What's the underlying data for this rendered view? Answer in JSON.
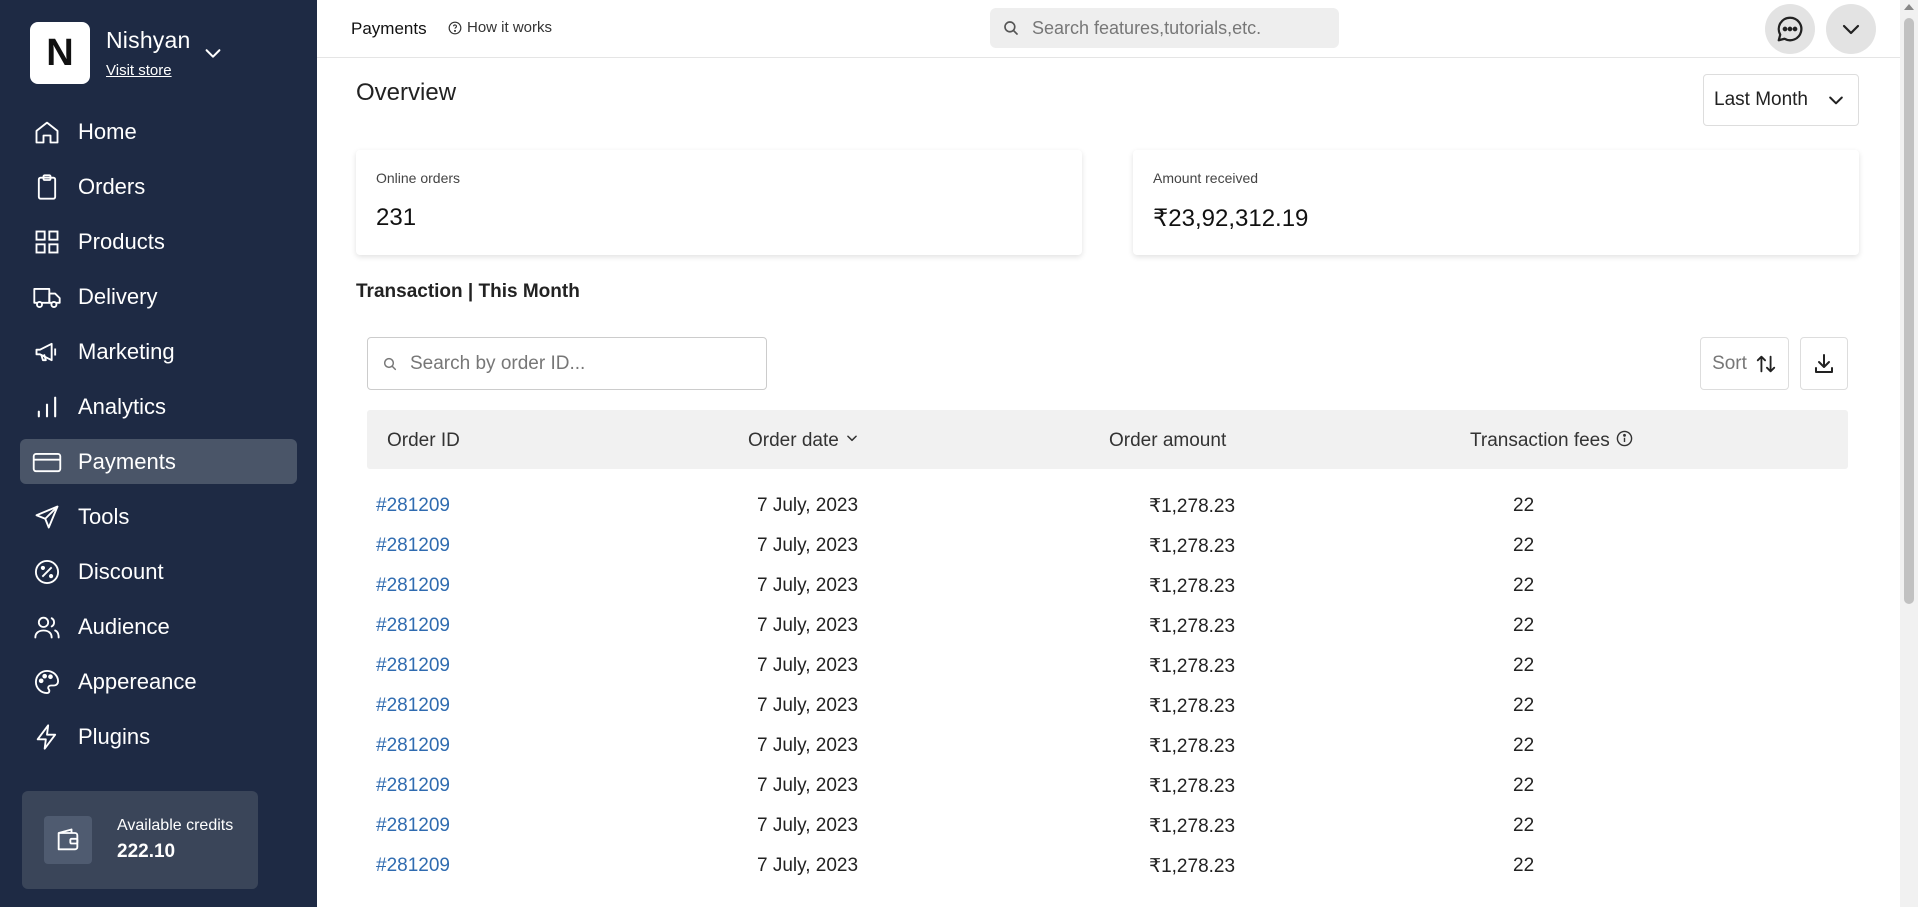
{
  "sidebar": {
    "store": {
      "logo_letter": "N",
      "name": "Nishyan",
      "visit_label": "Visit store"
    },
    "items": [
      {
        "label": "Home",
        "icon": "home-icon"
      },
      {
        "label": "Orders",
        "icon": "clipboard-icon"
      },
      {
        "label": "Products",
        "icon": "grid-icon"
      },
      {
        "label": "Delivery",
        "icon": "truck-icon"
      },
      {
        "label": "Marketing",
        "icon": "megaphone-icon"
      },
      {
        "label": "Analytics",
        "icon": "bar-chart-icon"
      },
      {
        "label": "Payments",
        "icon": "credit-card-icon",
        "active": true
      },
      {
        "label": "Tools",
        "icon": "send-icon"
      },
      {
        "label": "Discount",
        "icon": "discount-icon"
      },
      {
        "label": "Audience",
        "icon": "users-icon"
      },
      {
        "label": "Appereance",
        "icon": "palette-icon"
      },
      {
        "label": "Plugins",
        "icon": "lightning-icon"
      }
    ],
    "credits": {
      "label": "Available credits",
      "value": "222.10",
      "icon": "wallet-icon"
    }
  },
  "topbar": {
    "title": "Payments",
    "how_it_works": "How it works",
    "search_placeholder": "Search features,tutorials,etc."
  },
  "overview": {
    "title": "Overview",
    "range": "Last Month",
    "cards": [
      {
        "label": "Online orders",
        "value": "231"
      },
      {
        "label": "Amount received",
        "value": "₹23,92,312.19"
      }
    ]
  },
  "transactions": {
    "title": "Transaction | This Month",
    "search_placeholder": "Search by order ID...",
    "sort_label": "Sort",
    "columns": [
      "Order ID",
      "Order date",
      "Order amount",
      "Transaction fees"
    ],
    "rows": [
      {
        "id": "#281209",
        "date": "7 July, 2023",
        "amount": "₹1,278.23",
        "fee": "22"
      },
      {
        "id": "#281209",
        "date": "7 July, 2023",
        "amount": "₹1,278.23",
        "fee": "22"
      },
      {
        "id": "#281209",
        "date": "7 July, 2023",
        "amount": "₹1,278.23",
        "fee": "22"
      },
      {
        "id": "#281209",
        "date": "7 July, 2023",
        "amount": "₹1,278.23",
        "fee": "22"
      },
      {
        "id": "#281209",
        "date": "7 July, 2023",
        "amount": "₹1,278.23",
        "fee": "22"
      },
      {
        "id": "#281209",
        "date": "7 July, 2023",
        "amount": "₹1,278.23",
        "fee": "22"
      },
      {
        "id": "#281209",
        "date": "7 July, 2023",
        "amount": "₹1,278.23",
        "fee": "22"
      },
      {
        "id": "#281209",
        "date": "7 July, 2023",
        "amount": "₹1,278.23",
        "fee": "22"
      },
      {
        "id": "#281209",
        "date": "7 July, 2023",
        "amount": "₹1,278.23",
        "fee": "22"
      },
      {
        "id": "#281209",
        "date": "7 July, 2023",
        "amount": "₹1,278.23",
        "fee": "22"
      }
    ]
  },
  "colors": {
    "sidebar_bg": "#1e2a44",
    "active_item_bg": "#4a5568",
    "link": "#2f6bb0"
  }
}
